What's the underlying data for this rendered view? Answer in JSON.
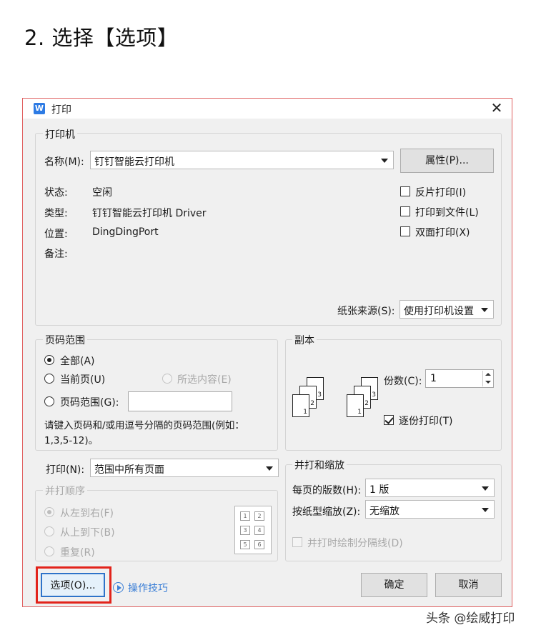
{
  "heading": "2. 选择【选项】",
  "dialog": {
    "title": "打印",
    "app_icon_letter": "W",
    "close_glyph": "✕"
  },
  "printer": {
    "group_title": "打印机",
    "name_label": "名称(M):",
    "name_value": "钉钉智能云打印机",
    "properties_button": "属性(P)...",
    "status_label": "状态:",
    "status_value": "空闲",
    "type_label": "类型:",
    "type_value": "钉钉智能云打印机 Driver",
    "location_label": "位置:",
    "location_value": "DingDingPort",
    "comment_label": "备注:",
    "options": [
      {
        "label": "反片打印(I)",
        "checked": false
      },
      {
        "label": "打印到文件(L)",
        "checked": false
      },
      {
        "label": "双面打印(X)",
        "checked": false
      }
    ],
    "paper_source_label": "纸张来源(S):",
    "paper_source_value": "使用打印机设置"
  },
  "page_range": {
    "group_title": "页码范围",
    "all": "全部(A)",
    "current_page": "当前页(U)",
    "selection": "所选内容(E)",
    "pages": "页码范围(G):",
    "pages_value": "",
    "hint": "请键入页码和/或用逗号分隔的页码范围(例如：1,3,5-12)。",
    "hint_line1": "请键入页码和/或用逗号分隔的页码范围(例如：",
    "hint_line2": "1,3,5-12)。"
  },
  "copies": {
    "group_title": "副本",
    "count_label": "份数(C):",
    "count_value": "1",
    "collate_label": "逐份打印(T)",
    "collate_checked": true,
    "sheet_numbers": [
      "1",
      "2",
      "3"
    ]
  },
  "print_what": {
    "label": "打印(N):",
    "value": "范围中所有页面"
  },
  "combine_order": {
    "group_title": "并打顺序",
    "left_to_right": "从左到右(F)",
    "top_to_bottom": "从上到下(B)",
    "repeat": "重复(R)",
    "grid_numbers": [
      "1",
      "2",
      "3",
      "4",
      "5",
      "6"
    ]
  },
  "zoom": {
    "group_title": "并打和缩放",
    "pages_per_sheet_label": "每页的版数(H):",
    "pages_per_sheet_value": "1 版",
    "scale_label": "按纸型缩放(Z):",
    "scale_value": "无缩放",
    "draw_lines_label": "并打时绘制分隔线(D)"
  },
  "footer": {
    "options_button": "选项(O)...",
    "tips_link": "操作技巧",
    "ok_button": "确定",
    "cancel_button": "取消"
  },
  "watermark": "头条 @绘威打印",
  "colors": {
    "highlight": "#e2231a",
    "link": "#3c7fd6",
    "app_icon": "#2d7be4"
  }
}
